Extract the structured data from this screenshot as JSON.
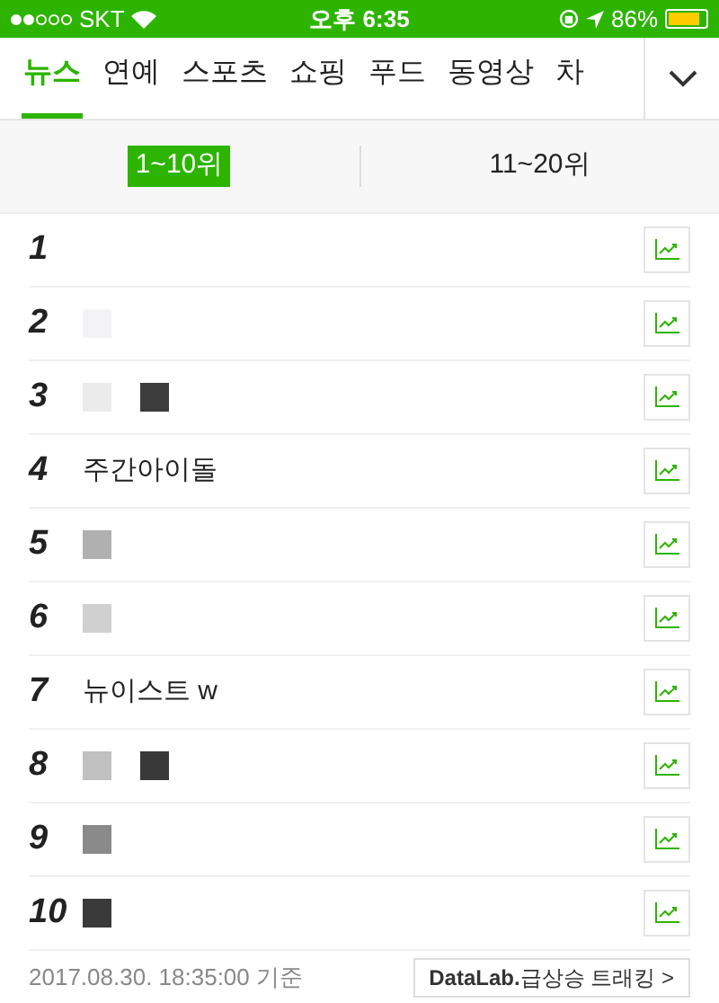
{
  "status_bar": {
    "carrier": "SKT",
    "time": "오후 6:35",
    "battery": "86%"
  },
  "tabs": [
    {
      "label": "뉴스",
      "selected": true
    },
    {
      "label": "연예",
      "selected": false
    },
    {
      "label": "스포츠",
      "selected": false
    },
    {
      "label": "쇼핑",
      "selected": false
    },
    {
      "label": "푸드",
      "selected": false
    },
    {
      "label": "동영상",
      "selected": false
    },
    {
      "label": "차",
      "selected": false
    }
  ],
  "ranges": [
    {
      "label": "1~10위",
      "selected": true
    },
    {
      "label": "11~20위",
      "selected": false
    }
  ],
  "rows": [
    {
      "rank": "1",
      "masks": []
    },
    {
      "rank": "2",
      "masks": [
        {
          "color": "#f3f3f5"
        }
      ]
    },
    {
      "rank": "3",
      "masks": [
        {
          "color": "#ebebeb"
        },
        {
          "color": "#3c3c3c"
        }
      ]
    },
    {
      "rank": "4",
      "keyword": "주간아이돌",
      "masks": []
    },
    {
      "rank": "5",
      "masks": [
        {
          "color": "#b0b0b0"
        }
      ]
    },
    {
      "rank": "6",
      "masks": [
        {
          "color": "#d0d0d0"
        }
      ]
    },
    {
      "rank": "7",
      "keyword": "뉴이스트 w",
      "masks": []
    },
    {
      "rank": "8",
      "masks": [
        {
          "color": "#c0c0c0"
        },
        {
          "color": "#383838"
        }
      ]
    },
    {
      "rank": "9",
      "masks": [
        {
          "color": "#8a8a8a"
        }
      ]
    },
    {
      "rank": "10",
      "masks": [
        {
          "color": "#3a3a3a"
        }
      ]
    }
  ],
  "footer": {
    "timestamp": "2017.08.30. 18:35:00 기준",
    "link": "**DataLab.**급상승 트래킹 >"
  }
}
